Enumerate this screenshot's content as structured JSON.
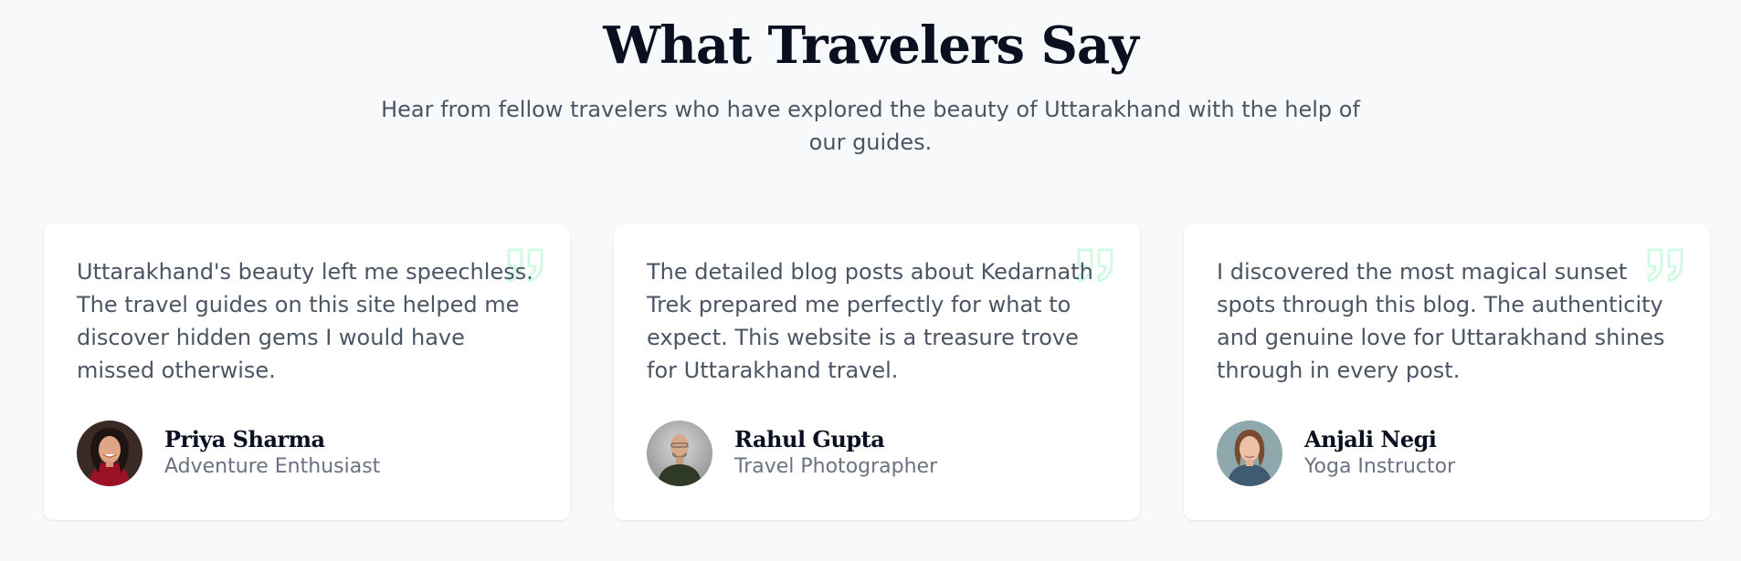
{
  "section": {
    "title": "What Travelers Say",
    "subtitle": "Hear from fellow travelers who have explored the beauty of Uttarakhand with the help of our guides."
  },
  "testimonials": [
    {
      "quote": "Uttarakhand's beauty left me speechless. The travel guides on this site helped me discover hidden gems I would have missed otherwise.",
      "name": "Priya Sharma",
      "role": "Adventure Enthusiast"
    },
    {
      "quote": "The detailed blog posts about Kedarnath Trek prepared me perfectly for what to expect. This website is a treasure trove for Uttarakhand travel.",
      "name": "Rahul Gupta",
      "role": "Travel Photographer"
    },
    {
      "quote": "I discovered the most magical sunset spots through this blog. The authenticity and genuine love for Uttarakhand shines through in every post.",
      "name": "Anjali Negi",
      "role": "Yoga Instructor"
    }
  ],
  "icons": {
    "quote": "quote-icon"
  },
  "colors": {
    "background": "#f8f9fb",
    "heading": "#0b1020",
    "body_text": "#4b5563",
    "muted_text": "#6b7280",
    "card": "#ffffff",
    "quote_icon": "#d1fae5"
  }
}
